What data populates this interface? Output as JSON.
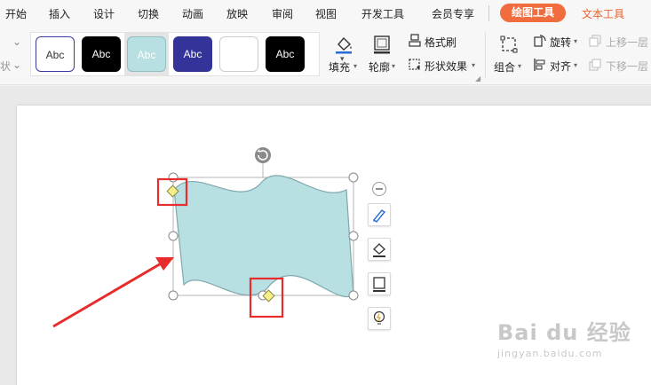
{
  "menu": {
    "items": [
      "开始",
      "插入",
      "设计",
      "切换",
      "动画",
      "放映",
      "审阅",
      "视图",
      "开发工具",
      "会员专享"
    ],
    "active_tab": "绘图工具",
    "text_tools": "文本工具"
  },
  "ribbon": {
    "left_fragment": "状",
    "styles": [
      "Abc",
      "Abc",
      "Abc",
      "Abc",
      "",
      "Abc"
    ],
    "fill_label": "填充",
    "outline_label": "轮廓",
    "format_painter_label": "格式刷",
    "shape_effects_label": "形状效果",
    "group_label": "组合",
    "rotate_label": "旋转",
    "align_label": "对齐",
    "bring_forward_label": "上移一层",
    "send_backward_label": "下移一层"
  },
  "colors": {
    "accent": "#f26d3d",
    "shape_fill": "#b8dfe2",
    "shape_stroke": "#7fa8ad",
    "annotation_red": "#e82c2c",
    "handle_yellow": "#f7f08a"
  },
  "watermark": {
    "main": "Bai du 经验",
    "sub": "jingyan.baidu.com"
  }
}
